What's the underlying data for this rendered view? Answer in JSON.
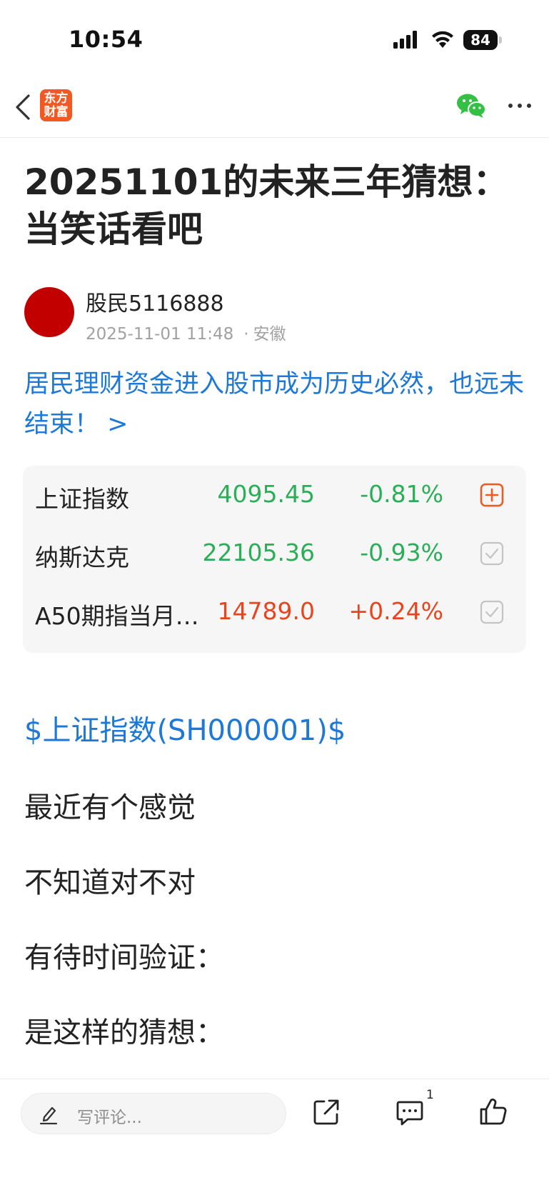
{
  "status_bar": {
    "time": "10:54",
    "battery": "84"
  },
  "nav": {
    "logo_text_line1": "东方",
    "logo_text_line2": "财富"
  },
  "article": {
    "title": "20251101的未来三年猜想：当笑话看吧",
    "author": {
      "name": "股民5116888",
      "date": "2025-11-01 11:48",
      "location": "安徽"
    },
    "promo_link": "居民理财资金进入股市成为历史必然，也远未结束！ >"
  },
  "quotes": [
    {
      "name": "上证指数",
      "price": "4095.45",
      "change": "-0.81%",
      "trend": "down",
      "action": "add"
    },
    {
      "name": "纳斯达克",
      "price": "22105.36",
      "change": "-0.93%",
      "trend": "down",
      "action": "added"
    },
    {
      "name": "A50期指当月…",
      "price": "14789.0",
      "change": "+0.24%",
      "trend": "up",
      "action": "added"
    }
  ],
  "content": {
    "stock_link": "$上证指数(SH000001)$",
    "lines": [
      "最近有个感觉",
      "不知道对不对",
      "有待时间验证：",
      "是这样的猜想："
    ]
  },
  "bottom_bar": {
    "comment_placeholder": "写评论...",
    "comment_count": "1"
  },
  "colors": {
    "brand_orange": "#f05a22",
    "link_blue": "#1e78d8",
    "down_green": "#2bae58",
    "up_red": "#e8451e",
    "wechat_green": "#33c045"
  },
  "icons": [
    "back-icon",
    "wechat-icon",
    "more-icon",
    "plus-icon",
    "check-icon",
    "pen-icon",
    "share-icon",
    "comment-icon",
    "like-icon"
  ]
}
